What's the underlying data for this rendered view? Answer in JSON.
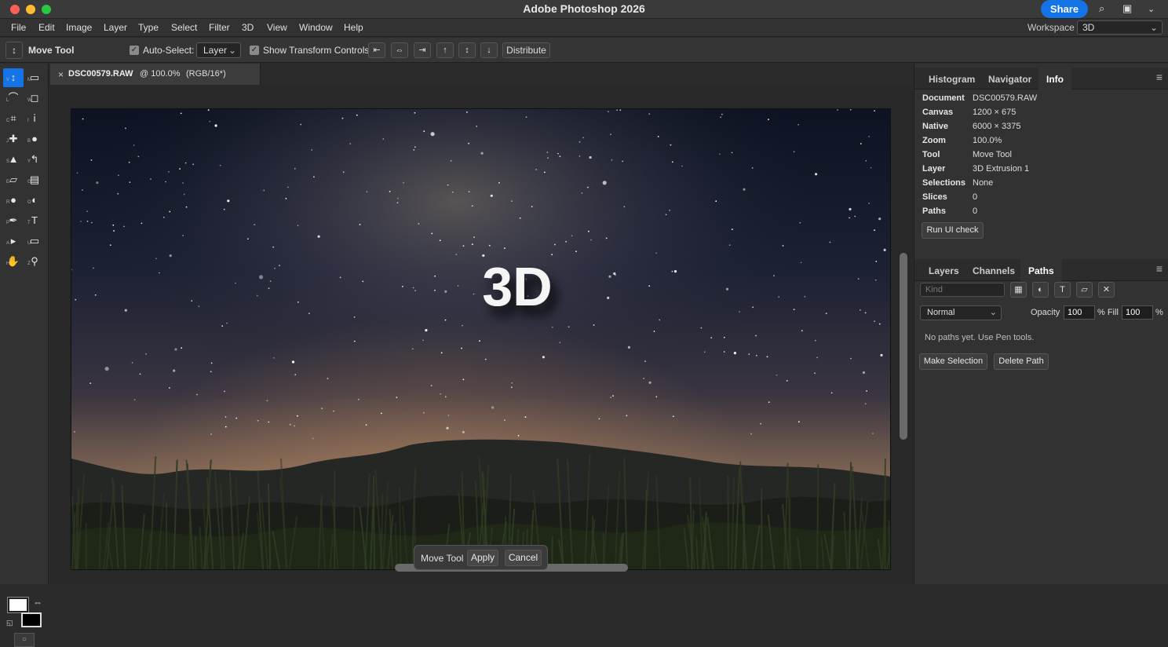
{
  "app": {
    "title": "Adobe Photoshop 2026",
    "share_label": "Share",
    "window_controls": {
      "close": "#ff5f57",
      "minimize": "#febc2e",
      "maximize": "#28c840"
    },
    "accent": "#1473e6"
  },
  "titlebar_icons": [
    "search-icon",
    "screen-mode-icon",
    "chevron-down-icon"
  ],
  "menu": [
    "File",
    "Edit",
    "Image",
    "Layer",
    "Type",
    "Select",
    "Filter",
    "3D",
    "View",
    "Window",
    "Help"
  ],
  "workspace": {
    "label": "Workspace",
    "value": "3D"
  },
  "options_bar": {
    "tool_name": "Move Tool",
    "auto_select_label": "Auto-Select:",
    "auto_select_checked": true,
    "auto_select_target": "Layer",
    "show_transform_label": "Show Transform Controls",
    "show_transform_checked": true,
    "align_buttons": [
      "align-left-icon",
      "align-h-center-icon",
      "align-right-icon",
      "align-top-icon",
      "align-v-center-icon",
      "align-bottom-icon"
    ],
    "distribute_label": "Distribute"
  },
  "tools": [
    {
      "name": "move-tool",
      "glyph": "↕",
      "key": "V",
      "active": true
    },
    {
      "name": "marquee-tool",
      "glyph": "▭",
      "key": "M"
    },
    {
      "name": "lasso-tool",
      "glyph": "⌒",
      "key": "L"
    },
    {
      "name": "select-frame-tool",
      "glyph": "◻",
      "key": "W"
    },
    {
      "name": "crop-tool",
      "glyph": "⌗",
      "key": "C"
    },
    {
      "name": "eyedropper-tool",
      "glyph": "ⅰ",
      "key": "I"
    },
    {
      "name": "healing-tool",
      "glyph": "✚",
      "key": "J"
    },
    {
      "name": "brush-tool",
      "glyph": "●",
      "key": "B"
    },
    {
      "name": "stamp-tool",
      "glyph": "▲",
      "key": "S"
    },
    {
      "name": "history-brush-tool",
      "glyph": "↰",
      "key": "Y"
    },
    {
      "name": "eraser-tool",
      "glyph": "▱",
      "key": "E"
    },
    {
      "name": "gradient-tool",
      "glyph": "▤",
      "key": "G"
    },
    {
      "name": "blur-tool",
      "glyph": "●",
      "key": "R"
    },
    {
      "name": "dodge-tool",
      "glyph": "◐",
      "key": "O"
    },
    {
      "name": "pen-tool",
      "glyph": "✒",
      "key": "P"
    },
    {
      "name": "type-tool",
      "glyph": "T",
      "key": "T"
    },
    {
      "name": "path-select-tool",
      "glyph": "▸",
      "key": "A"
    },
    {
      "name": "shape-tool",
      "glyph": "▭",
      "key": "U"
    },
    {
      "name": "hand-tool",
      "glyph": "✋",
      "key": "H"
    },
    {
      "name": "zoom-tool",
      "glyph": "⚲",
      "key": "Z"
    }
  ],
  "document": {
    "name": "DSC00579.RAW",
    "zoom": "@  100.0%",
    "mode": "(RGB/16*)",
    "overlay_text": "3D"
  },
  "hud": {
    "label": "Move Tool",
    "apply": "Apply",
    "cancel": "Cancel"
  },
  "info_panel": {
    "tabs": [
      "Histogram",
      "Navigator",
      "Info"
    ],
    "active_tab": "Info",
    "rows": [
      {
        "key": "Document",
        "value": "DSC00579.RAW"
      },
      {
        "key": "Canvas",
        "value": "1200 × 675"
      },
      {
        "key": "Native",
        "value": "6000 × 3375"
      },
      {
        "key": "Zoom",
        "value": "100.0%"
      },
      {
        "key": "Tool",
        "value": "Move Tool"
      },
      {
        "key": "Layer",
        "value": "3D Extrusion 1"
      },
      {
        "key": "Selections",
        "value": "None"
      },
      {
        "key": "Slices",
        "value": "0"
      },
      {
        "key": "Paths",
        "value": "0"
      }
    ],
    "check_button": "Run UI check"
  },
  "paths_panel": {
    "tabs": [
      "Layers",
      "Channels",
      "Paths"
    ],
    "active_tab": "Paths",
    "kind_placeholder": "Kind",
    "filter_icons": [
      "pixel-filter-icon",
      "adjustment-filter-icon",
      "type-filter-icon",
      "shape-filter-icon",
      "clear-filter-icon"
    ],
    "blend_mode": "Normal",
    "opacity_label": "Opacity",
    "opacity_value": "100",
    "fill_label": "% Fill",
    "fill_value": "100",
    "percent": "%",
    "empty_message": "No paths yet. Use Pen tools.",
    "make_selection": "Make Selection",
    "delete_path": "Delete Path"
  }
}
